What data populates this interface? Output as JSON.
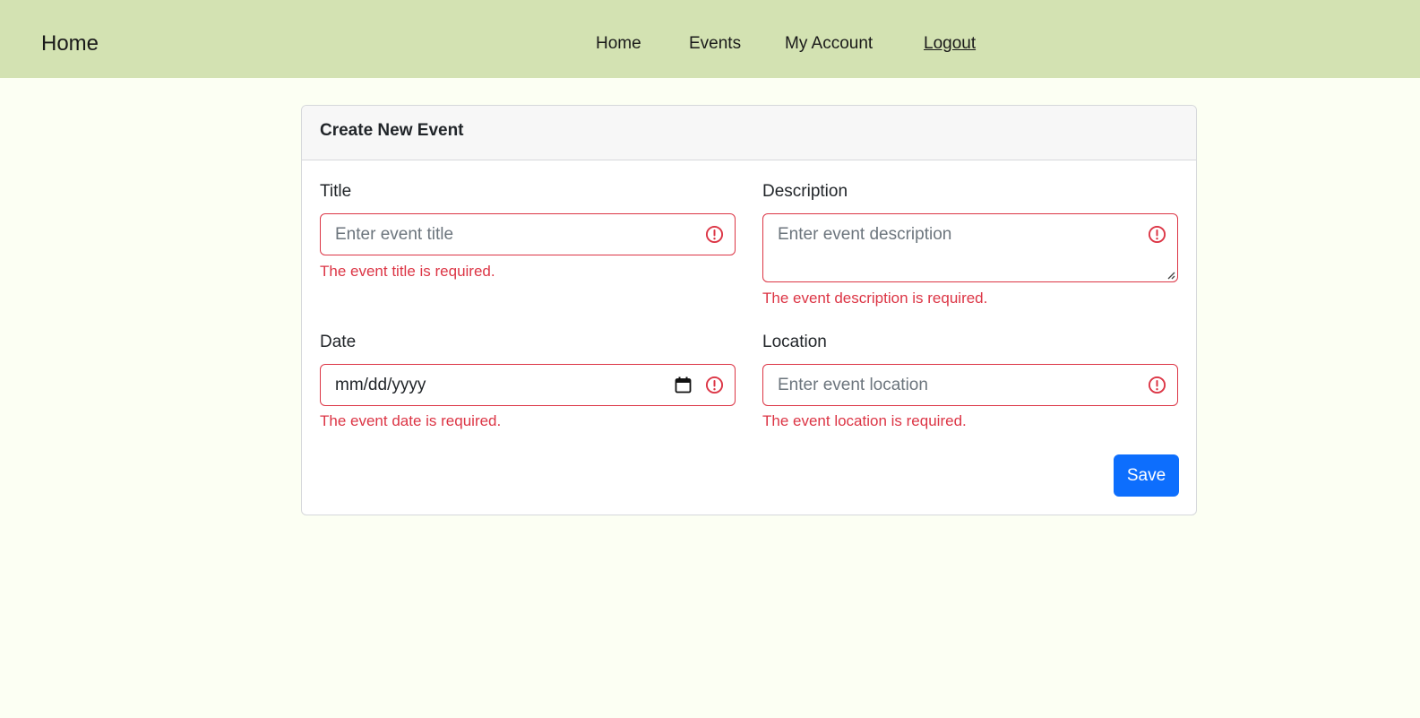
{
  "navbar": {
    "brand": "Home",
    "links": [
      "Home",
      "Events",
      "My Account",
      "Logout"
    ]
  },
  "form": {
    "heading": "Create New Event",
    "title": {
      "label": "Title",
      "placeholder": "Enter event title",
      "error": "The event title is required."
    },
    "description": {
      "label": "Description",
      "placeholder": "Enter event description",
      "error": "The event description is required."
    },
    "date": {
      "label": "Date",
      "value": "mm/dd/yyyy",
      "error": "The event date is required."
    },
    "location": {
      "label": "Location",
      "placeholder": "Enter event location",
      "error": "The event location is required."
    },
    "save_label": "Save"
  },
  "colors": {
    "navbar_bg": "#d3e2b2",
    "page_bg": "#fcfff3",
    "error": "#dc3545",
    "primary": "#0d6efd"
  },
  "icons": {
    "field_status": "exclamation-circle-icon",
    "date_picker": "calendar-icon",
    "textarea_resize": "resize-handle-icon"
  }
}
